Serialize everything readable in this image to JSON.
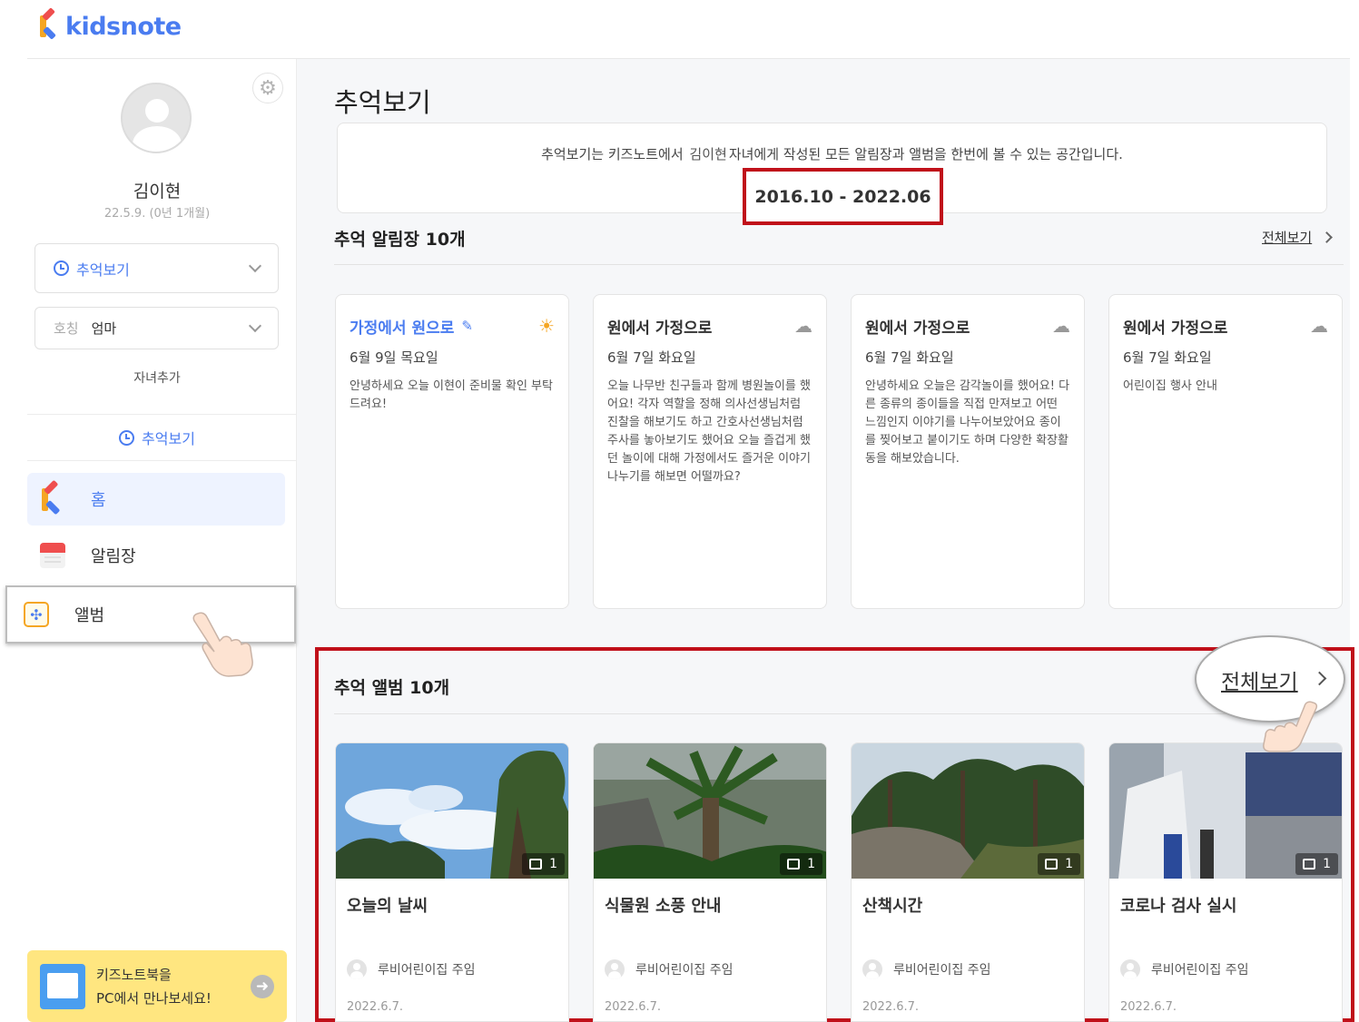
{
  "app": {
    "logo_text": "kidsnote"
  },
  "sidebar": {
    "child_name": "김이현",
    "child_birth": "22.5.9. (0년 1개월)",
    "mode_select": {
      "label": "추억보기",
      "icon": "clock-icon"
    },
    "title_select": {
      "sub": "호칭",
      "value": "엄마"
    },
    "add_child": "자녀추가",
    "memory_link": "추억보기",
    "nav": [
      {
        "label": "홈",
        "icon": "kidsnote-k-icon"
      },
      {
        "label": "알림장",
        "icon": "calendar-icon"
      },
      {
        "label": "앨범",
        "icon": "album-pinwheel-icon"
      }
    ],
    "banner": {
      "line1": "키즈노트북을",
      "line2": "PC에서 만나보세요!"
    }
  },
  "main": {
    "page_title": "추억보기",
    "intro": {
      "prefix": "추억보기는 키즈노트에서",
      "name": "김이현",
      "suffix": "자녀에게 작성된 모든 알림장과 앨범을 한번에 볼 수 있는 공간입니다."
    },
    "date_range": "2016.10 - 2022.06",
    "notice_section": {
      "title": "추억 알림장 10개",
      "see_all": "전체보기"
    },
    "notices": [
      {
        "direction": "가정에서 원으로",
        "date": "6월 9일 목요일",
        "body": "안녕하세요 오늘 이현이 준비물 확인 부탁드려요!",
        "weather": "sunny",
        "highlight": true
      },
      {
        "direction": "원에서 가정으로",
        "date": "6월 7일 화요일",
        "body": "오늘 나무반 친구들과 함께 병원놀이를 했어요! 각자 역할을 정해 의사선생님처럼 진찰을 해보기도 하고 간호사선생님처럼 주사를 놓아보기도 했어요 오늘 즐겁게 했던 놀이에 대해 가정에서도 즐거운 이야기 나누기를 해보면 어떨까요?",
        "weather": "cloudy",
        "highlight": false
      },
      {
        "direction": "원에서 가정으로",
        "date": "6월 7일 화요일",
        "body": "안녕하세요 오늘은 감각놀이를 했어요! 다른 종류의 종이들을 직접 만져보고 어떤 느낌인지 이야기를 나누어보았어요 종이를 찢어보고 붙이기도 하며 다양한 확장활동을 해보았습니다.",
        "weather": "cloudy",
        "highlight": false
      },
      {
        "direction": "원에서 가정으로",
        "date": "6월 7일 화요일",
        "body": "어린이집 행사 안내",
        "weather": "cloudy",
        "highlight": false
      }
    ],
    "album_section": {
      "title": "추억 앨범 10개",
      "see_all": "전체보기"
    },
    "albums": [
      {
        "title": "오늘의 날씨",
        "author": "루비어린이집 주임",
        "date": "2022.6.7.",
        "count": "1",
        "photo": "sky-with-trees"
      },
      {
        "title": "식물원 소풍 안내",
        "author": "루비어린이집 주임",
        "date": "2022.6.7.",
        "count": "1",
        "photo": "palm-tree-garden"
      },
      {
        "title": "산책시간",
        "author": "루비어린이집 주임",
        "date": "2022.6.7.",
        "count": "1",
        "photo": "pine-forest"
      },
      {
        "title": "코로나 검사 실시",
        "author": "루비어린이집 주임",
        "date": "2022.6.7.",
        "count": "1",
        "photo": "covid-test-site"
      }
    ]
  },
  "colors": {
    "brand_blue": "#4a7cf0",
    "highlight_red": "#c0101a",
    "banner_yellow": "#ffe680"
  }
}
